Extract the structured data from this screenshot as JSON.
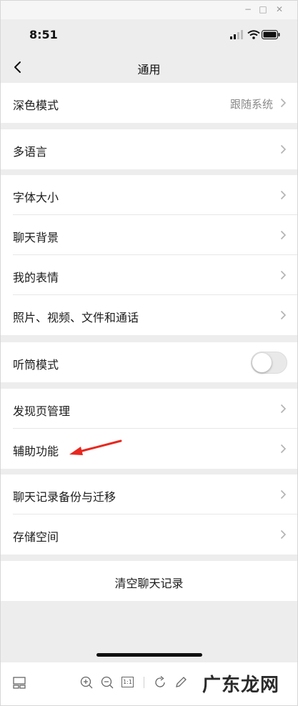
{
  "window": {
    "minimize_glyph": "−",
    "maximize_glyph": "□",
    "close_glyph": "✕"
  },
  "status": {
    "time": "8:51",
    "icons": [
      "signal-icon",
      "wifi-icon",
      "battery-icon"
    ]
  },
  "nav": {
    "title": "通用",
    "back_icon": "chevron-left-icon"
  },
  "groups": [
    {
      "rows": [
        {
          "label": "深色模式",
          "value": "跟随系统"
        }
      ]
    },
    {
      "rows": [
        {
          "label": "多语言"
        }
      ]
    },
    {
      "rows": [
        {
          "label": "字体大小"
        },
        {
          "label": "聊天背景"
        },
        {
          "label": "我的表情"
        },
        {
          "label": "照片、视频、文件和通话"
        }
      ]
    },
    {
      "rows": [
        {
          "label": "听筒模式",
          "toggle": false
        }
      ]
    },
    {
      "rows": [
        {
          "label": "发现页管理"
        },
        {
          "label": "辅助功能"
        }
      ]
    },
    {
      "rows": [
        {
          "label": "聊天记录备份与迁移"
        },
        {
          "label": "存储空间"
        }
      ]
    }
  ],
  "clear_history": {
    "label": "清空聊天记录"
  },
  "annotation": {
    "type": "red-arrow",
    "color": "#e8281f",
    "points_to": "辅助功能"
  },
  "toolbar": {
    "zoom_reset_label": "1:1",
    "icons": [
      "layout-icon",
      "zoom-in-icon",
      "zoom-out-icon",
      "actual-size-icon",
      "rotate-icon",
      "edit-icon"
    ],
    "watermark": "广东龙网"
  },
  "colors": {
    "background": "#ededed",
    "card": "#ffffff",
    "secondary_text": "#8a8a8a",
    "arrow": "#e8281f"
  }
}
